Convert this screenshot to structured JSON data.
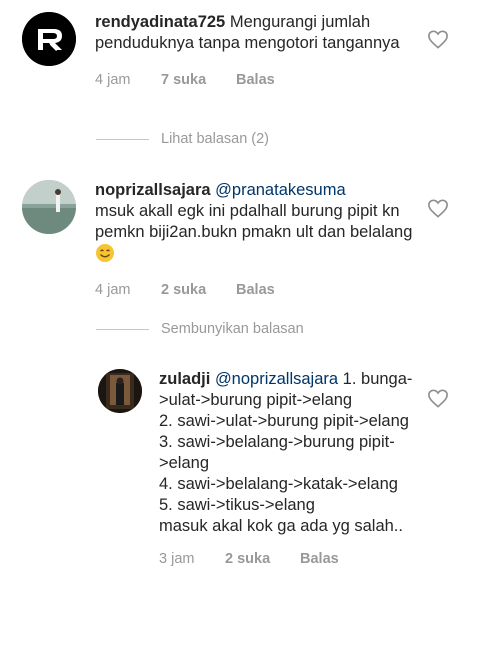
{
  "comments": [
    {
      "username": "rendyadinata725",
      "mention": "",
      "text": "Mengurangi jumlah penduduknya tanpa mengotori tangannya",
      "time": "4 jam",
      "likes": "7 suka",
      "reply_label": "Balas"
    },
    {
      "username": "noprizallsajara",
      "mention": "@pranatakesuma",
      "text": "msuk akall egk ini pdalhall burung pipit kn  pemkn biji2an.bukn pmakn ult dan belalang",
      "time": "4 jam",
      "likes": "2 suka",
      "reply_label": "Balas"
    },
    {
      "username": "zuladji",
      "mention": "@noprizallsajara",
      "text": "1. bunga->ulat->burung pipit->elang\n2. sawi->ulat->burung pipit->elang\n3. sawi->belalang->burung pipit->elang\n4.  sawi->belalang->katak->elang\n5. sawi->tikus->elang\nmasuk akal kok ga ada yg salah..",
      "time": "3 jam",
      "likes": "2 suka",
      "reply_label": "Balas"
    }
  ],
  "view_replies": "Lihat balasan (2)",
  "hide_replies": "Sembunyikan balasan",
  "colors": {
    "text": "#262626",
    "meta": "#999999",
    "mention": "#003569",
    "divider": "#c7c7c7"
  },
  "icons": {
    "like": "heart-outline-icon",
    "emoji": "smiling-face-emoji"
  }
}
